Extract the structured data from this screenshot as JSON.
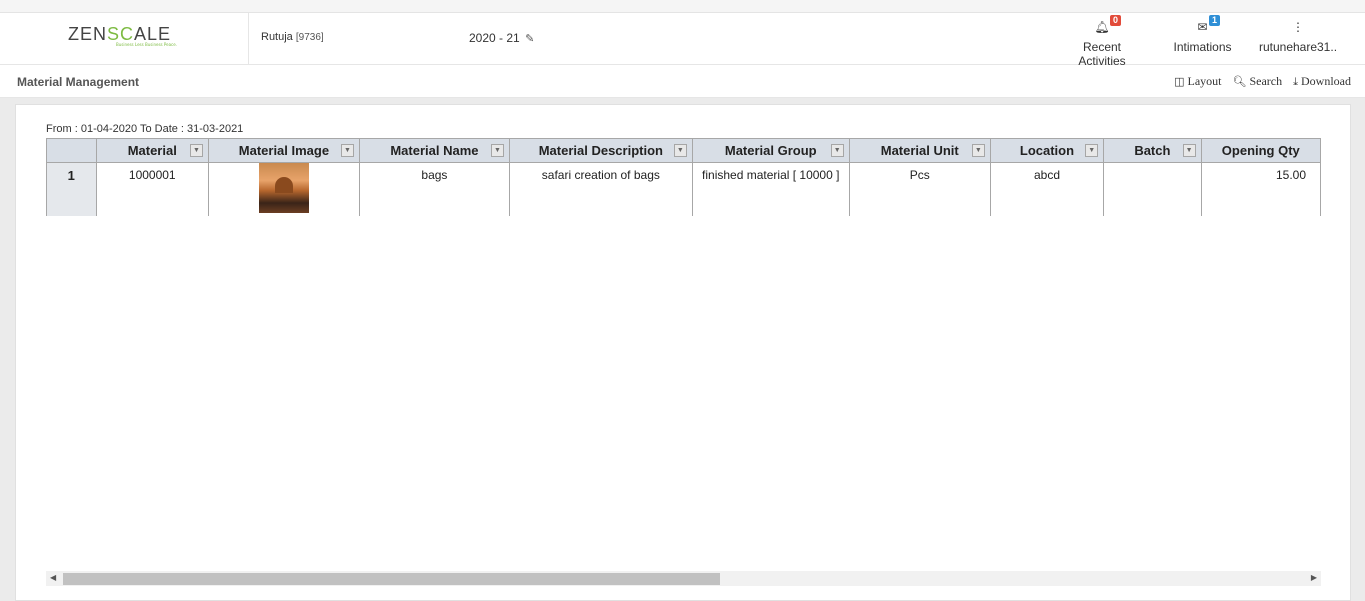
{
  "header": {
    "logo_pre": "ZEN",
    "logo_accent": "SC",
    "logo_post": "ALE",
    "logo_tagline": "Business Less Business Peace.",
    "company": "Rutuja",
    "company_code": "[9736]",
    "financial_year": "2020 - 21",
    "recent_activities_label": "Recent Activities",
    "recent_activities_count": "0",
    "intimations_label": "Intimations",
    "intimations_count": "1",
    "user_label": "rutunehare31..",
    "badge_colors": {
      "activities": "#e24b3a",
      "intimations": "#2f8fd6"
    }
  },
  "subbar": {
    "title": "Material Management",
    "layout_label": "Layout",
    "search_label": "Search",
    "download_label": "Download"
  },
  "report": {
    "date_range": "From : 01-04-2020 To Date : 31-03-2021",
    "columns": [
      "Material",
      "Material Image",
      "Material Name",
      "Material Description",
      "Material Group",
      "Material Unit",
      "Location",
      "Batch",
      "Opening Qty"
    ],
    "rows": [
      {
        "row_no": "1",
        "material": "1000001",
        "material_name": "bags",
        "material_description": "safari creation of bags",
        "material_group": "finished material [ 10000 ]",
        "material_unit": "Pcs",
        "location": "abcd",
        "batch": "",
        "opening_qty": "15.00"
      }
    ]
  },
  "colors": {
    "accent": "#7dbb42",
    "header_bg": "#d8dee6"
  }
}
